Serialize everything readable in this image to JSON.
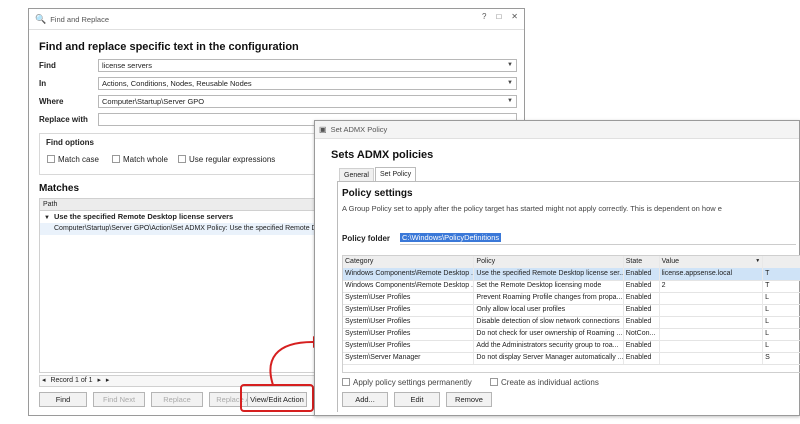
{
  "find_replace": {
    "title": "Find and Replace",
    "heading": "Find and replace specific text in the configuration",
    "find_label": "Find",
    "find_value": "license servers",
    "in_label": "In",
    "in_value": "Actions, Conditions, Nodes, Reusable Nodes",
    "where_label": "Where",
    "where_value": "Computer\\Startup\\Server GPO",
    "replace_label": "Replace with",
    "replace_value": "",
    "options_title": "Find options",
    "options": {
      "match_case": "Match case",
      "match_whole": "Match whole",
      "regex": "Use regular expressions"
    },
    "matches_title": "Matches",
    "path_header": "Path",
    "group_label": "Use the specified Remote Desktop license servers",
    "match_row": "Computer\\Startup\\Server GPO\\Action\\Set ADMX Policy: Use the specified Remote Desktop license servers",
    "record_label": "Record 1 of 1",
    "buttons": {
      "find": "Find",
      "find_next": "Find Next",
      "replace": "Replace",
      "replace_all": "Replace All",
      "view_edit": "View/Edit Action"
    }
  },
  "admx": {
    "title": "Set ADMX Policy",
    "heading": "Sets ADMX policies",
    "tabs": [
      "General",
      "Set Policy"
    ],
    "section_title": "Policy settings",
    "description": "A Group Policy set to apply after the policy target has started might not apply correctly. This is dependent on how e",
    "folder_label": "Policy folder",
    "folder_value": "C:\\Windows\\PolicyDefinitions",
    "columns": [
      "Category",
      "Policy",
      "State",
      "Value"
    ],
    "rows": [
      [
        "Windows Components\\Remote Desktop ...",
        "Use the specified Remote Desktop license ser...",
        "Enabled",
        "license.appsense.local",
        "T"
      ],
      [
        "Windows Components\\Remote Desktop ...",
        "Set the Remote Desktop licensing mode",
        "Enabled",
        "2",
        "T"
      ],
      [
        "System\\User Profiles",
        "Prevent Roaming Profile changes from propa...",
        "Enabled",
        "",
        "L"
      ],
      [
        "System\\User Profiles",
        "Only allow local user profiles",
        "Enabled",
        "",
        "L"
      ],
      [
        "System\\User Profiles",
        "Disable detection of slow network connections",
        "Enabled",
        "",
        "L"
      ],
      [
        "System\\User Profiles",
        "Do not check for user ownership of Roaming ...",
        "NotCon...",
        "",
        "L"
      ],
      [
        "System\\User Profiles",
        "Add the Administrators security group to roa...",
        "Enabled",
        "",
        "L"
      ],
      [
        "System\\Server Manager",
        "Do not display Server Manager automatically ...",
        "Enabled",
        "",
        "S"
      ]
    ],
    "apply_permanent": "Apply policy settings permanently",
    "create_individual": "Create as individual actions",
    "buttons": {
      "add": "Add...",
      "edit": "Edit",
      "remove": "Remove"
    }
  },
  "colors": {
    "highlight_red": "#d61f1f",
    "selection_blue": "#3a78d8",
    "row_selected": "#cfe3f7"
  }
}
